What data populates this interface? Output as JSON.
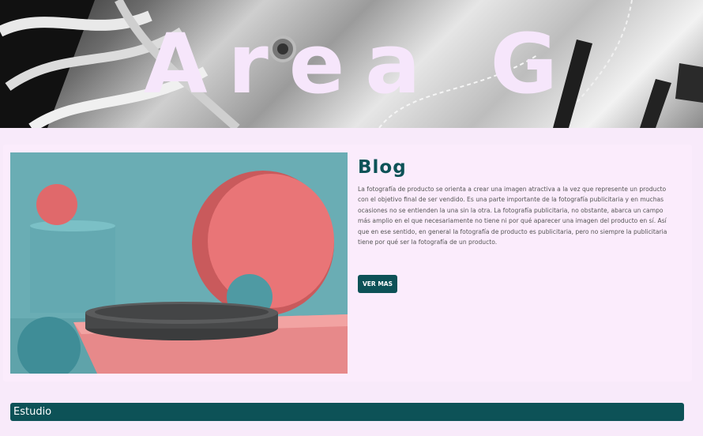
{
  "hero": {
    "title": "Area G"
  },
  "blog": {
    "title": "Blog",
    "text": "La fotografía de producto se orienta a crear una imagen atractiva a la vez que represente un producto con el objetivo final de ser vendido. Es una parte importante de la fotografía publicitaria y en muchas ocasiones no se entienden la una sin la otra. La fotografía publicitaria, no obstante, abarca un campo más amplio en el que necesariamente no tiene ni por qué aparecer una imagen del producto en sí. Así que en ese sentido, en general la fotografía de producto es publicitaria, pero no siempre la publicitaria tiene por qué ser la fotografía de un producto.",
    "button_label": "VER MAS"
  },
  "section": {
    "label": "Estudio"
  },
  "colors": {
    "accent": "#0d5257",
    "background": "#f8eafa",
    "hero_title": "#f6e6fb"
  }
}
